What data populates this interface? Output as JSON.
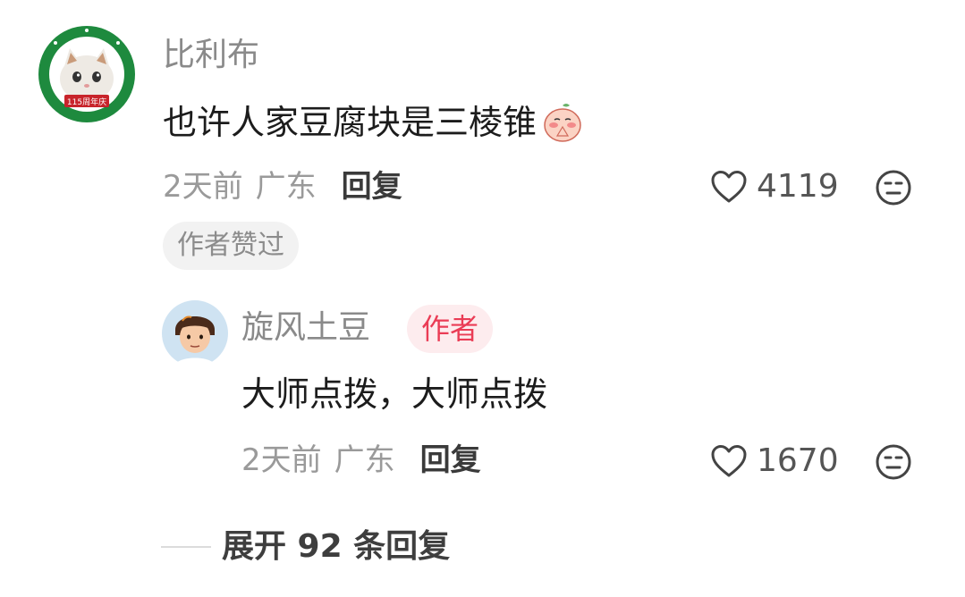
{
  "main_comment": {
    "username": "比利布",
    "text": "也许人家豆腐块是三棱锥",
    "emoji": "pray-emoji",
    "time": "2天前",
    "location": "广东",
    "reply_label": "回复",
    "likes": "4119",
    "liked_badge": "作者赞过",
    "avatar_emblem_text": "115周年庆"
  },
  "reply": {
    "username": "旋风土豆",
    "author_badge": "作者",
    "text": "大师点拨，大师点拨",
    "time": "2天前",
    "location": "广东",
    "reply_label": "回复",
    "likes": "1670"
  },
  "expand": {
    "label": "展开 92 条回复"
  },
  "colors": {
    "author_badge_bg": "#fdecee",
    "author_badge_text": "#ea3c55",
    "avatar_ring": "#1e8a3e"
  }
}
